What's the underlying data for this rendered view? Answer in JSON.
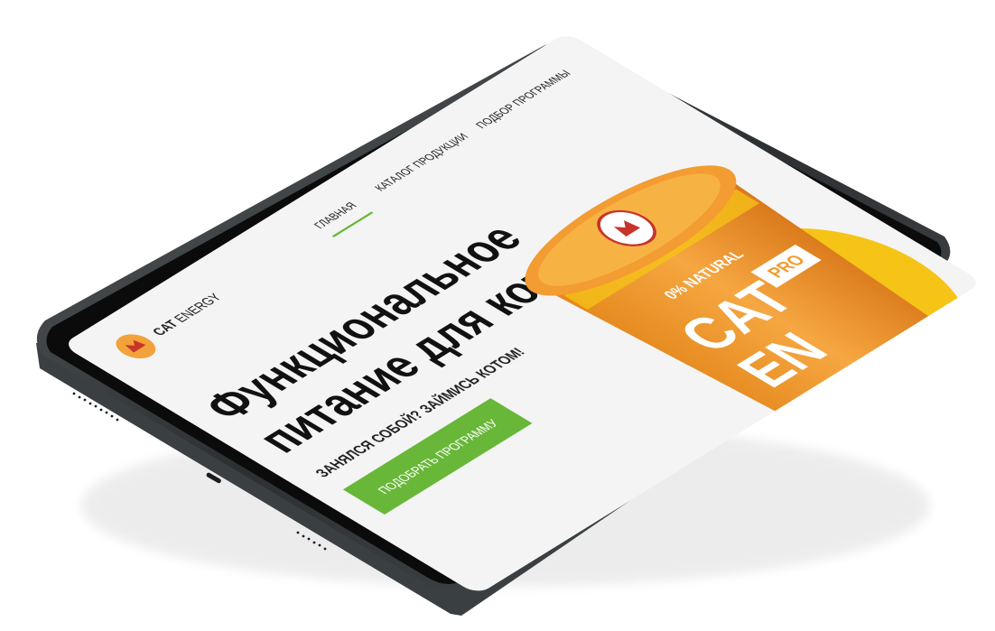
{
  "site": {
    "brand": {
      "strong": "CAT",
      "light": " ENERGY"
    },
    "nav": [
      {
        "label": "ГЛАВНАЯ",
        "active": true
      },
      {
        "label": "КАТАЛОГ ПРОДУКЦИИ",
        "active": false
      },
      {
        "label": "ПОДБОР ПРОГРАММЫ",
        "active": false
      }
    ],
    "hero": {
      "title_line1": "Функциональное",
      "title_line2": "питание для котов",
      "subtitle": "ЗАНЯЛСЯ СОБОЙ? ЗАЙМИСЬ КОТОМ!",
      "cta_label": "ПОДОБРАТЬ ПРОГРАММУ"
    },
    "product": {
      "badge_text": "0% NATURAL",
      "name_line1": "CAT",
      "name_line2": "EN",
      "pro_label": "PRO"
    }
  },
  "colors": {
    "accent_green": "#68b738",
    "product_orange": "#f29a2e",
    "lid_orange": "#f39c32",
    "circle_yellow": "#f6c417",
    "logo_orange": "#f2a23a",
    "text_dark": "#222222",
    "device_frame": "#2f3335",
    "screen_bezel": "#0a0a0a",
    "screen_bg": "#f4f4f4"
  }
}
